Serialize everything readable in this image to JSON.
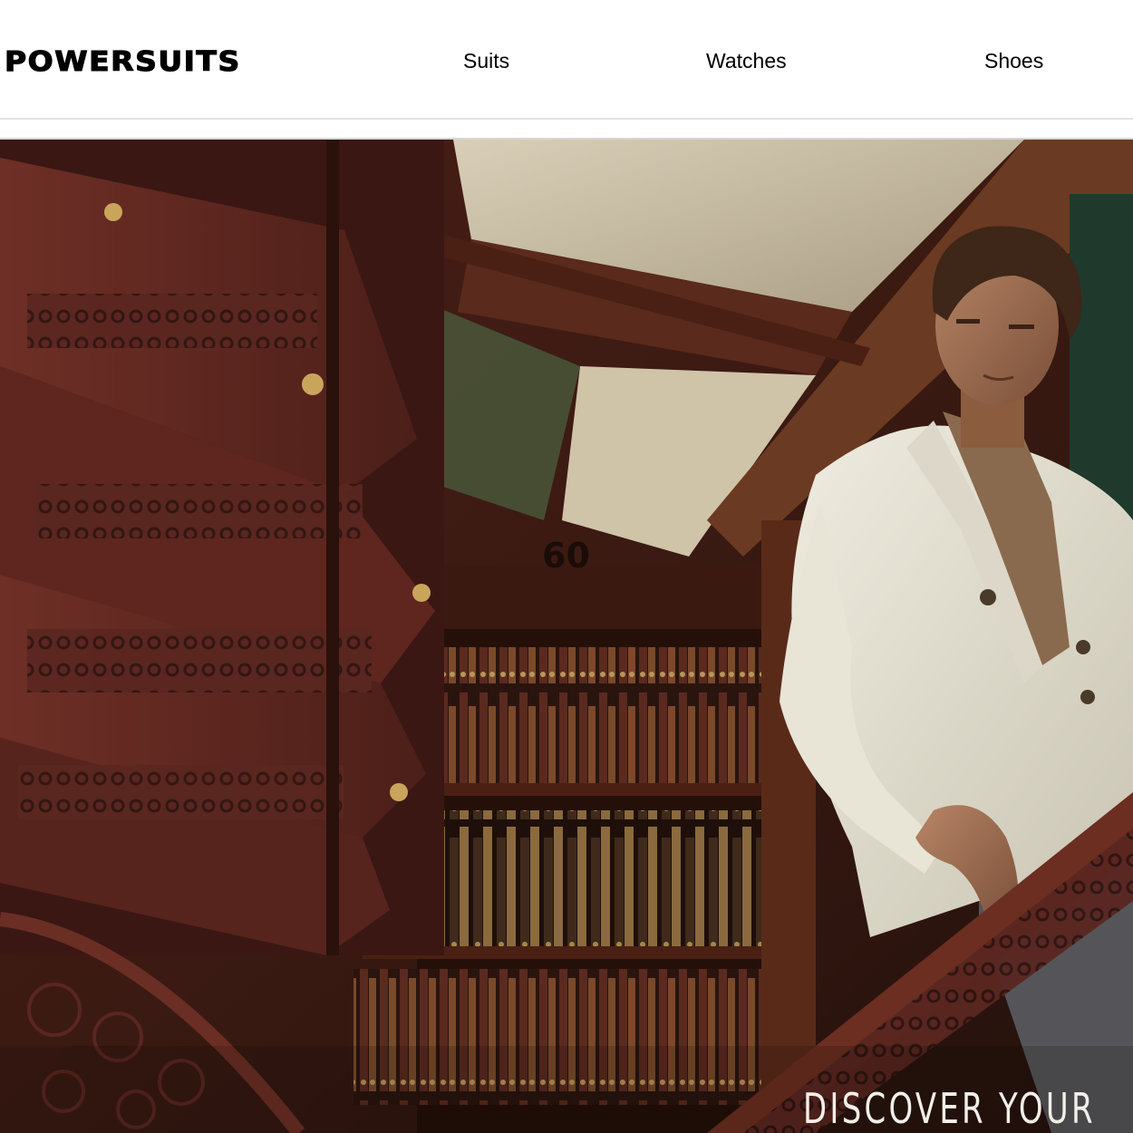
{
  "brand": {
    "logo_text": "POWERSUITS"
  },
  "nav": {
    "items": [
      {
        "label": "Suits"
      },
      {
        "label": "Watches"
      },
      {
        "label": "Shoes"
      }
    ]
  },
  "hero": {
    "tagline": "DISCOVER YOUR"
  },
  "colors": {
    "header_bg": "#ffffff",
    "text": "#000000",
    "hero_tagline": "#f2efe9"
  }
}
